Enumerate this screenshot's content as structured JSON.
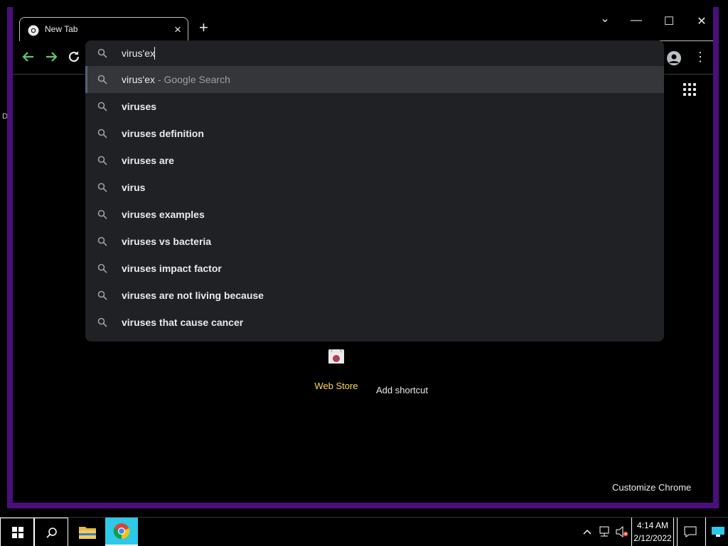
{
  "desktop": {
    "edge_letter": "D"
  },
  "browser": {
    "tab": {
      "title": "New Tab",
      "close_icon": "×"
    },
    "new_tab_icon": "+",
    "window_controls": {
      "dropdown": "⌄",
      "minimize": "—",
      "maximize": "☐",
      "close": "✕"
    },
    "omnibox": {
      "typed_text": "virus'ex",
      "suggestions": [
        {
          "text": "virus'ex",
          "suffix": " - Google Search",
          "bold": false
        },
        {
          "text": "viruses",
          "suffix": "",
          "bold": true
        },
        {
          "text": "viruses definition",
          "suffix": "",
          "bold": true
        },
        {
          "text": "viruses are",
          "suffix": "",
          "bold": true
        },
        {
          "text": "virus",
          "suffix": "",
          "bold": true
        },
        {
          "text": "viruses examples",
          "suffix": "",
          "bold": true
        },
        {
          "text": "viruses vs bacteria",
          "suffix": "",
          "bold": true
        },
        {
          "text": "viruses impact factor",
          "suffix": "",
          "bold": true
        },
        {
          "text": "viruses are not living because",
          "suffix": "",
          "bold": true
        },
        {
          "text": "viruses that cause cancer",
          "suffix": "",
          "bold": true
        }
      ]
    },
    "new_tab_page": {
      "shortcut_web_store": "Web Store",
      "add_shortcut": "Add shortcut",
      "customize": "Customize Chrome"
    }
  },
  "taskbar": {
    "clock_time": "4:14 AM",
    "clock_date": "2/12/2022"
  },
  "colors": {
    "accent_frame": "#4b0f7d",
    "nav_arrow": "#5ec96e",
    "web_store_label": "#fdd663",
    "chrome_taskbar": "#2ec8e8"
  }
}
